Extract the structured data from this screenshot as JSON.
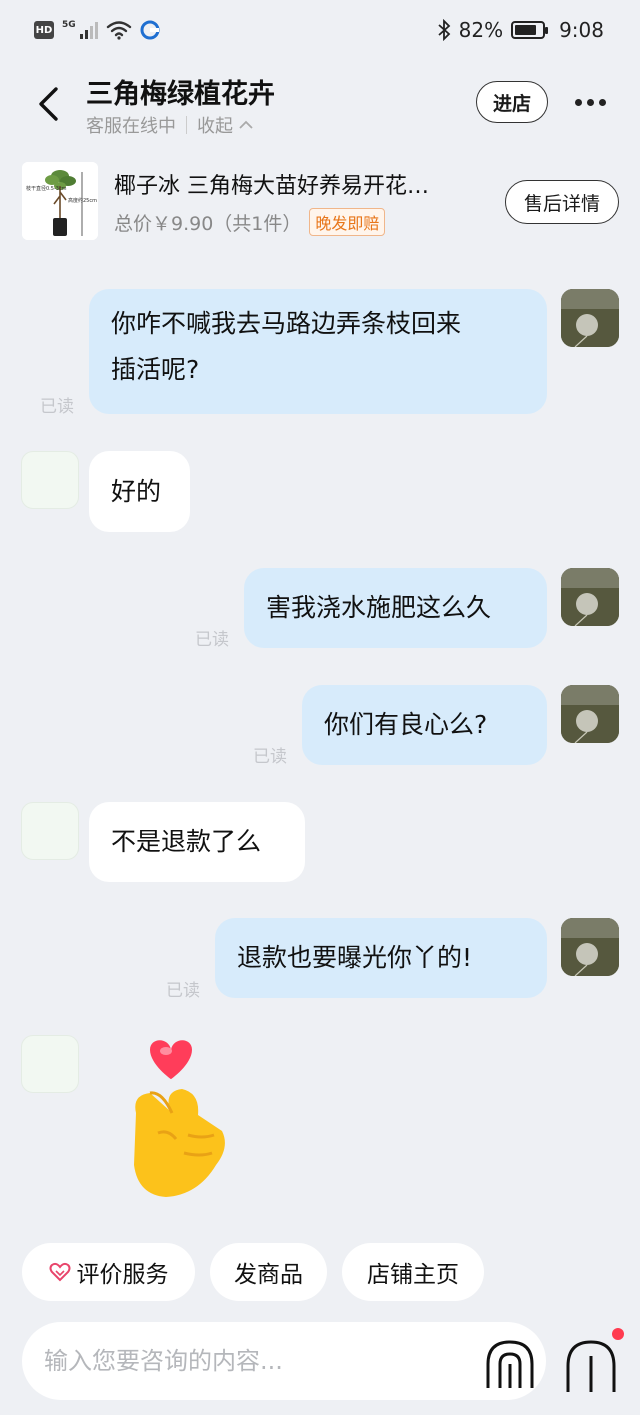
{
  "status_bar": {
    "hd": "HD",
    "network": "5G",
    "battery_percent": "82%",
    "time": "9:08",
    "battery_level": 0.82
  },
  "header": {
    "title": "三角梅绿植花卉",
    "online_status": "客服在线中",
    "collapse": "收起",
    "enter_store": "进店"
  },
  "product": {
    "name": "椰子冰 三角梅大苗好养易开花…",
    "price": "总价￥9.90（共1件）",
    "badge": "晚发即赔",
    "after_sale": "售后详情",
    "image_text_1": "枝干直径0.5-3cm",
    "image_text_2": "高度约25cm"
  },
  "messages": [
    {
      "from": "self",
      "line1": "你咋不喊我去马路边弄条枝回来",
      "line2": "插活呢?",
      "read": "已读"
    },
    {
      "from": "shop",
      "text": "好的"
    },
    {
      "from": "self",
      "text": "害我浇水施肥这么久",
      "read": "已读"
    },
    {
      "from": "self",
      "text": "你们有良心么?",
      "read": "已读"
    },
    {
      "from": "shop",
      "text": "不是退款了么"
    },
    {
      "from": "self",
      "text": "退款也要曝光你丫的!",
      "read": "已读"
    },
    {
      "from": "shop",
      "sticker": "finger-heart-sticker"
    }
  ],
  "quick_actions": [
    "评价服务",
    "发商品",
    "店铺主页"
  ],
  "input": {
    "placeholder": "输入您要咨询的内容..."
  },
  "colors": {
    "background": "#eef0f4",
    "outgoing_bubble": "#d7ebfb",
    "incoming_bubble": "#ffffff",
    "badge_orange": "#e8761a",
    "notification_red": "#ff3b4f"
  }
}
